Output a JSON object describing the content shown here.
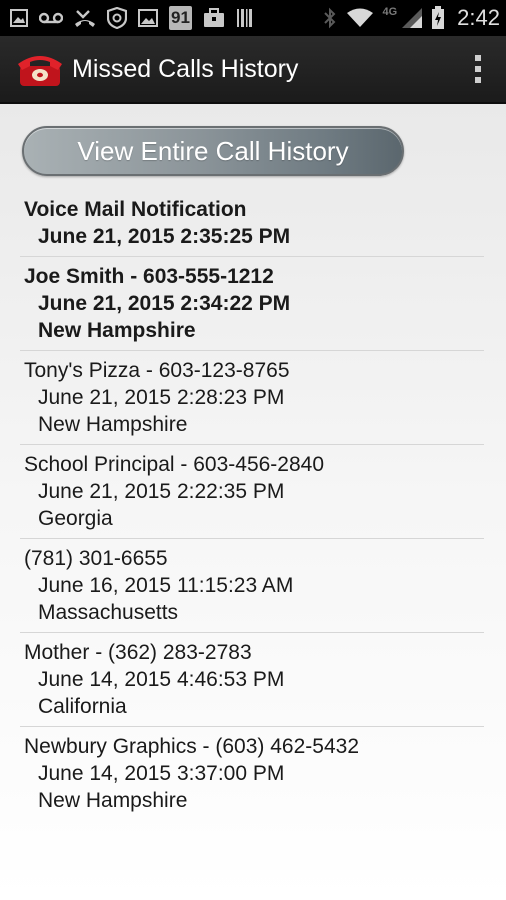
{
  "statusbar": {
    "badge_text": "91",
    "network_label": "4G",
    "time": "2:42",
    "icons": [
      "image-icon",
      "voicemail-icon",
      "missed-call-icon",
      "shield-icon",
      "gallery-icon",
      "notification-91-icon",
      "briefcase-icon",
      "barcode-icon",
      "bluetooth-icon",
      "wifi-icon",
      "signal-icon",
      "battery-icon"
    ]
  },
  "app": {
    "title": "Missed Calls History",
    "icon": "red-telephone-icon",
    "overflow_icon": "overflow-menu-icon"
  },
  "main": {
    "view_all_label": "View Entire Call History",
    "calls": [
      {
        "name_line": "Voice Mail Notification",
        "time": "June 21, 2015 2:35:25 PM",
        "location": "",
        "unread": true
      },
      {
        "name_line": "Joe Smith - 603-555-1212",
        "time": "June 21, 2015 2:34:22 PM",
        "location": "New Hampshire",
        "unread": true
      },
      {
        "name_line": "Tony's Pizza - 603-123-8765",
        "time": "June 21, 2015 2:28:23 PM",
        "location": "New Hampshire",
        "unread": false
      },
      {
        "name_line": "School Principal - 603-456-2840",
        "time": "June 21, 2015 2:22:35 PM",
        "location": "Georgia",
        "unread": false
      },
      {
        "name_line": "(781) 301-6655",
        "time": "June 16, 2015 11:15:23 AM",
        "location": "Massachusetts",
        "unread": false
      },
      {
        "name_line": "Mother - (362) 283-2783",
        "time": "June 14, 2015 4:46:53 PM",
        "location": "California",
        "unread": false
      },
      {
        "name_line": "Newbury Graphics - (603) 462-5432",
        "time": "June 14, 2015 3:37:00 PM",
        "location": "New Hampshire",
        "unread": false
      }
    ]
  }
}
